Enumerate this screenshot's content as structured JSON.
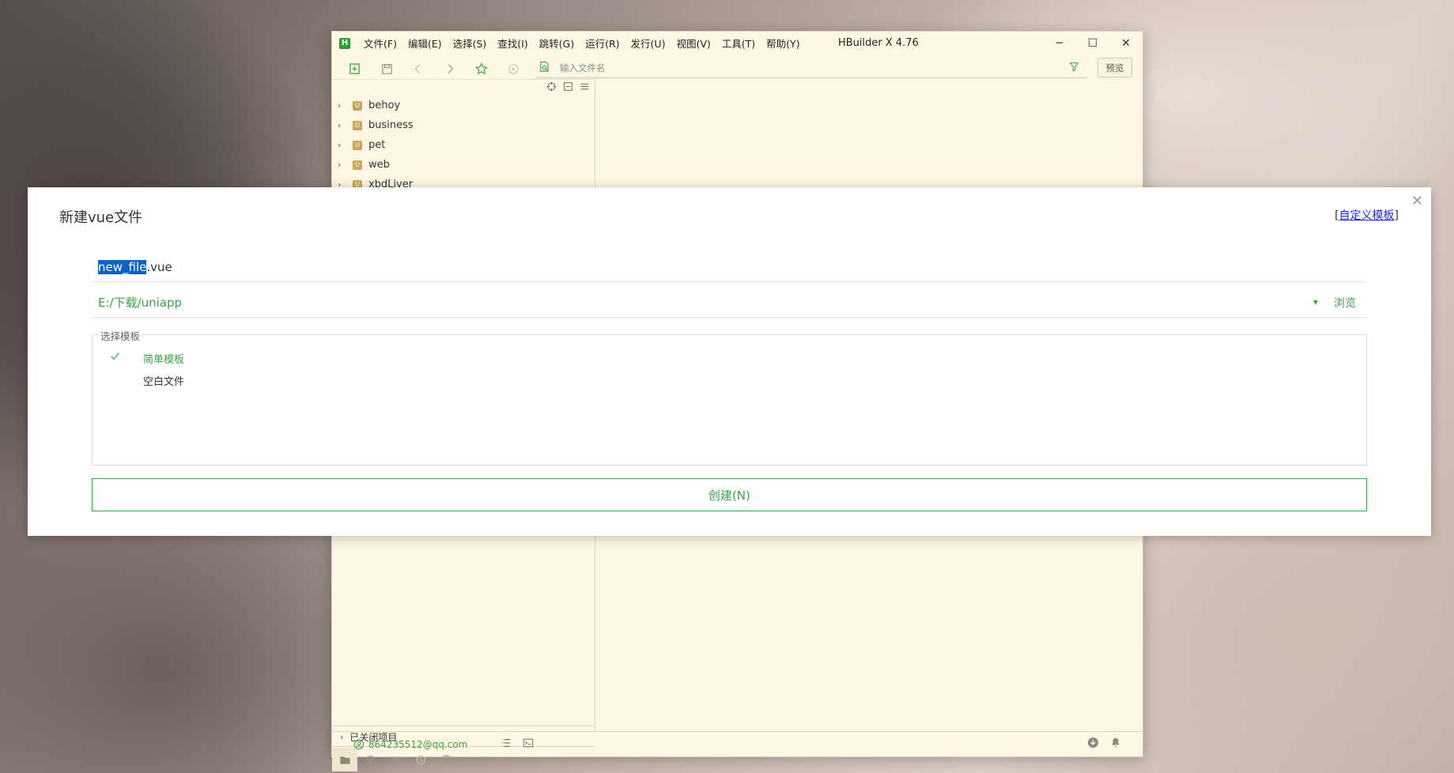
{
  "window": {
    "app_title": "HBuilder X 4.76",
    "logo": "H",
    "menu": [
      "文件(F)",
      "编辑(E)",
      "选择(S)",
      "查找(I)",
      "跳转(G)",
      "运行(R)",
      "发行(U)",
      "视图(V)",
      "工具(T)",
      "帮助(Y)"
    ],
    "controls": {
      "minimize": "─",
      "maximize": "☐",
      "close": "✕"
    }
  },
  "toolbar": {
    "search_placeholder": "输入文件名",
    "preview_label": "预览"
  },
  "sidebar": {
    "projects": [
      {
        "name": "behoy"
      },
      {
        "name": "business"
      },
      {
        "name": "pet"
      },
      {
        "name": "web"
      },
      {
        "name": "xbdLiver"
      }
    ],
    "closed_projects_label": "已关闭项目"
  },
  "status": {
    "user_email": "864235512@qq.com"
  },
  "dialog": {
    "title": "新建vue文件",
    "custom_template_bracket_open": "[",
    "custom_template_link": "自定义模板",
    "custom_template_bracket_close": "]",
    "file_name_selected": "new_file",
    "file_ext": ".vue",
    "path": "E:/下载/uniapp",
    "browse_label": "浏览",
    "template_legend": "选择模板",
    "templates": [
      {
        "label": "简单模板",
        "selected": true
      },
      {
        "label": "空白文件",
        "selected": false
      }
    ],
    "create_button": "创建(N)",
    "close_icon": "✕"
  },
  "colors": {
    "accent": "#3ba34a",
    "selection": "#0a62c9",
    "link": "#1a2ec8",
    "window_bg": "#fdf7e4"
  }
}
